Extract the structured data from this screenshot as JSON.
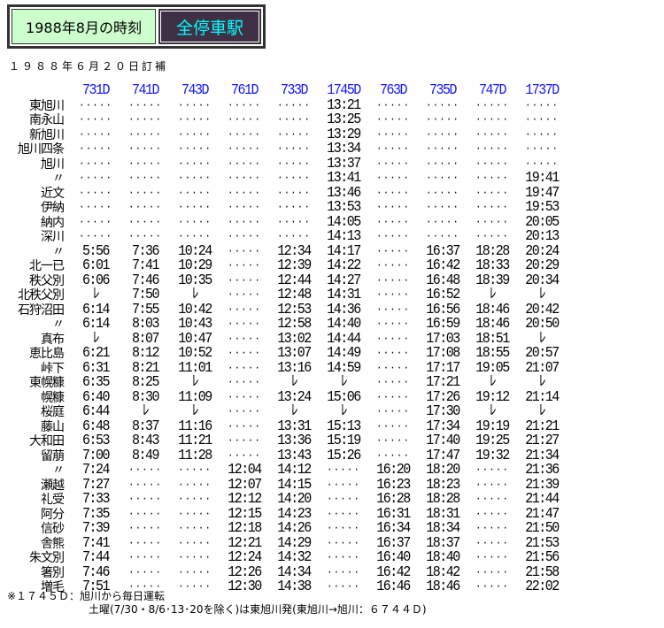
{
  "header": {
    "title": "1988年8月の時刻",
    "category": "全停車駅"
  },
  "subtitle": "１９８８年６月２０日訂補",
  "timetable": {
    "trains": [
      "731D",
      "741D",
      "743D",
      "761D",
      "733D",
      "1745D",
      "763D",
      "735D",
      "747D",
      "1737D"
    ],
    "no_service": "·····",
    "pass": "ﾚ",
    "rows": [
      {
        "station": "東旭川",
        "times": [
          "-",
          "-",
          "-",
          "-",
          "-",
          "13:21",
          "-",
          "-",
          "-",
          "-"
        ]
      },
      {
        "station": "南永山",
        "times": [
          "-",
          "-",
          "-",
          "-",
          "-",
          "13:25",
          "-",
          "-",
          "-",
          "-"
        ]
      },
      {
        "station": "新旭川",
        "times": [
          "-",
          "-",
          "-",
          "-",
          "-",
          "13:29",
          "-",
          "-",
          "-",
          "-"
        ]
      },
      {
        "station": "旭川四条",
        "times": [
          "-",
          "-",
          "-",
          "-",
          "-",
          "13:34",
          "-",
          "-",
          "-",
          "-"
        ]
      },
      {
        "station": "旭川",
        "times": [
          "-",
          "-",
          "-",
          "-",
          "-",
          "13:37",
          "-",
          "-",
          "-",
          "-"
        ]
      },
      {
        "station": "〃",
        "times": [
          "-",
          "-",
          "-",
          "-",
          "-",
          "13:41",
          "-",
          "-",
          "-",
          "19:41"
        ]
      },
      {
        "station": "近文",
        "times": [
          "-",
          "-",
          "-",
          "-",
          "-",
          "13:46",
          "-",
          "-",
          "-",
          "19:47"
        ]
      },
      {
        "station": "伊納",
        "times": [
          "-",
          "-",
          "-",
          "-",
          "-",
          "13:53",
          "-",
          "-",
          "-",
          "19:53"
        ]
      },
      {
        "station": "納内",
        "times": [
          "-",
          "-",
          "-",
          "-",
          "-",
          "14:05",
          "-",
          "-",
          "-",
          "20:05"
        ]
      },
      {
        "station": "深川",
        "times": [
          "-",
          "-",
          "-",
          "-",
          "-",
          "14:13",
          "-",
          "-",
          "-",
          "20:13"
        ]
      },
      {
        "station": "〃",
        "times": [
          "5:56",
          "7:36",
          "10:24",
          "-",
          "12:34",
          "14:17",
          "-",
          "16:37",
          "18:28",
          "20:24"
        ]
      },
      {
        "station": "北一已",
        "times": [
          "6:01",
          "7:41",
          "10:29",
          "-",
          "12:39",
          "14:22",
          "-",
          "16:42",
          "18:33",
          "20:29"
        ]
      },
      {
        "station": "秩父別",
        "times": [
          "6:06",
          "7:46",
          "10:35",
          "-",
          "12:44",
          "14:27",
          "-",
          "16:48",
          "18:39",
          "20:34"
        ]
      },
      {
        "station": "北秩父別",
        "times": [
          "L",
          "7:50",
          "L",
          "-",
          "12:48",
          "14:31",
          "-",
          "16:52",
          "L",
          "L"
        ]
      },
      {
        "station": "石狩沼田",
        "times": [
          "6:14",
          "7:55",
          "10:42",
          "-",
          "12:53",
          "14:36",
          "-",
          "16:56",
          "18:46",
          "20:42"
        ]
      },
      {
        "station": "〃",
        "times": [
          "6:14",
          "8:03",
          "10:43",
          "-",
          "12:58",
          "14:40",
          "-",
          "16:59",
          "18:46",
          "20:50"
        ]
      },
      {
        "station": "真布",
        "times": [
          "L",
          "8:07",
          "10:47",
          "-",
          "13:02",
          "14:44",
          "-",
          "17:03",
          "18:51",
          "L"
        ]
      },
      {
        "station": "恵比島",
        "times": [
          "6:21",
          "8:12",
          "10:52",
          "-",
          "13:07",
          "14:49",
          "-",
          "17:08",
          "18:55",
          "20:57"
        ]
      },
      {
        "station": "峠下",
        "times": [
          "6:31",
          "8:21",
          "11:01",
          "-",
          "13:16",
          "14:59",
          "-",
          "17:17",
          "19:05",
          "21:07"
        ]
      },
      {
        "station": "東幌糠",
        "times": [
          "6:35",
          "8:25",
          "L",
          "-",
          "L",
          "L",
          "-",
          "17:21",
          "L",
          "L"
        ]
      },
      {
        "station": "幌糠",
        "times": [
          "6:40",
          "8:30",
          "11:09",
          "-",
          "13:24",
          "15:06",
          "-",
          "17:26",
          "19:12",
          "21:14"
        ]
      },
      {
        "station": "桜庭",
        "times": [
          "6:44",
          "L",
          "L",
          "-",
          "L",
          "L",
          "-",
          "17:30",
          "L",
          "L"
        ]
      },
      {
        "station": "藤山",
        "times": [
          "6:48",
          "8:37",
          "11:16",
          "-",
          "13:31",
          "15:13",
          "-",
          "17:34",
          "19:19",
          "21:21"
        ]
      },
      {
        "station": "大和田",
        "times": [
          "6:53",
          "8:43",
          "11:21",
          "-",
          "13:36",
          "15:19",
          "-",
          "17:40",
          "19:25",
          "21:27"
        ]
      },
      {
        "station": "留萠",
        "times": [
          "7:00",
          "8:49",
          "11:28",
          "-",
          "13:43",
          "15:26",
          "-",
          "17:47",
          "19:32",
          "21:34"
        ]
      },
      {
        "station": "〃",
        "times": [
          "7:24",
          "-",
          "-",
          "12:04",
          "14:12",
          "-",
          "16:20",
          "18:20",
          "-",
          "21:36"
        ]
      },
      {
        "station": "瀬越",
        "times": [
          "7:27",
          "-",
          "-",
          "12:07",
          "14:15",
          "-",
          "16:23",
          "18:23",
          "-",
          "21:39"
        ]
      },
      {
        "station": "礼受",
        "times": [
          "7:33",
          "-",
          "-",
          "12:12",
          "14:20",
          "-",
          "16:28",
          "18:28",
          "-",
          "21:44"
        ]
      },
      {
        "station": "阿分",
        "times": [
          "7:35",
          "-",
          "-",
          "12:15",
          "14:23",
          "-",
          "16:31",
          "18:31",
          "-",
          "21:47"
        ]
      },
      {
        "station": "信砂",
        "times": [
          "7:39",
          "-",
          "-",
          "12:18",
          "14:26",
          "-",
          "16:34",
          "18:34",
          "-",
          "21:50"
        ]
      },
      {
        "station": "舎熊",
        "times": [
          "7:41",
          "-",
          "-",
          "12:21",
          "14:29",
          "-",
          "16:37",
          "18:37",
          "-",
          "21:53"
        ]
      },
      {
        "station": "朱文別",
        "times": [
          "7:44",
          "-",
          "-",
          "12:24",
          "14:32",
          "-",
          "16:40",
          "18:40",
          "-",
          "21:56"
        ]
      },
      {
        "station": "箸別",
        "times": [
          "7:46",
          "-",
          "-",
          "12:26",
          "14:34",
          "-",
          "16:42",
          "18:42",
          "-",
          "21:58"
        ]
      },
      {
        "station": "増毛",
        "times": [
          "7:51",
          "-",
          "-",
          "12:30",
          "14:38",
          "-",
          "16:46",
          "18:46",
          "-",
          "22:02"
        ]
      }
    ]
  },
  "notes": {
    "line1": "※１７４５Ｄ：旭川から毎日運転",
    "line2": "土曜(7/30・8/6･13･20を除く)は東旭川発(東旭川→旭川：６７４４Ｄ)"
  },
  "colors": {
    "header_left_bg": "#ccffcc",
    "header_right_bg": "#403045",
    "header_right_text": "#00ffff",
    "train_number": "#1515ff"
  }
}
